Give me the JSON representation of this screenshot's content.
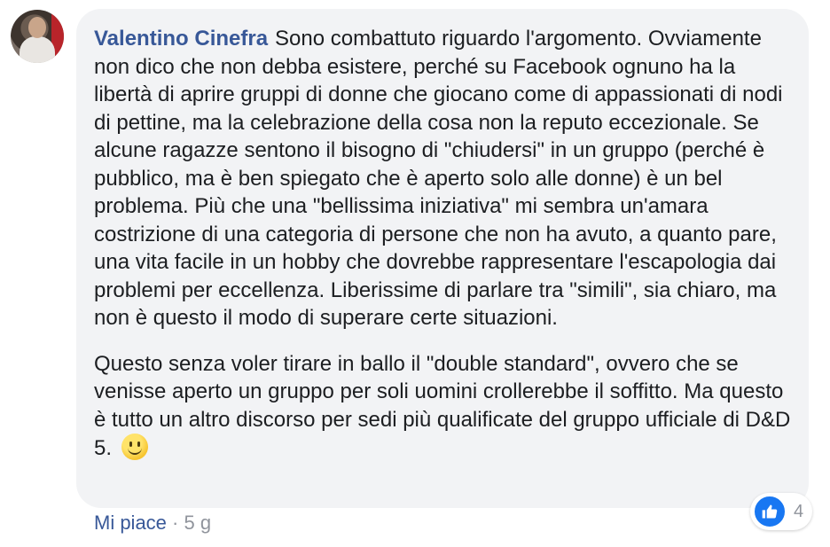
{
  "comment": {
    "author": "Valentino Cinefra",
    "paragraph1": "Sono combattuto riguardo l'argomento. Ovviamente non dico che non debba esistere, perché su Facebook ognuno ha la libertà di aprire gruppi di donne che giocano come di appassionati di nodi di pettine, ma la celebrazione della cosa non la reputo eccezionale. Se alcune ragazze sentono il bisogno di \"chiudersi\" in un gruppo (perché è pubblico, ma è ben spiegato che è aperto solo alle donne) è un bel problema. Più che una \"bellissima iniziativa\" mi sembra un'amara costrizione di una categoria di persone che non ha avuto, a quanto pare, una vita facile in un hobby che dovrebbe rappresentare l'escapologia dai problemi per eccellenza. Liberissime di parlare tra \"simili\", sia chiaro, ma non è questo il modo di superare certe situazioni.",
    "paragraph2": "Questo senza voler tirare in ballo il \"double standard\", ovvero che se venisse aperto un gruppo per soli uomini crollerebbe il soffitto. Ma questo è tutto un altro discorso per sedi più qualificate del gruppo ufficiale di D&D 5."
  },
  "actions": {
    "like_label": "Mi piace",
    "separator": "·",
    "time": "5 g"
  },
  "reactions": {
    "count": "4",
    "icon": "thumbs-up-icon",
    "color": "#1877f2"
  },
  "colors": {
    "author": "#385898",
    "bubble": "#f2f3f5",
    "text": "#1c1e21",
    "muted": "#90949c"
  }
}
